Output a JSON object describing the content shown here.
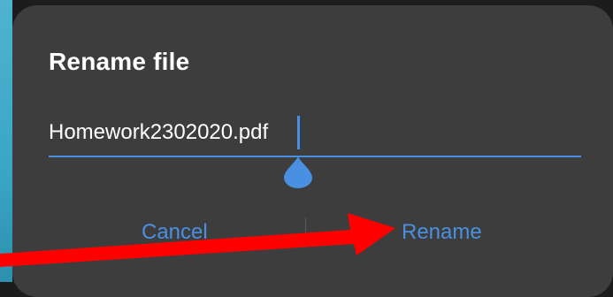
{
  "dialog": {
    "title": "Rename file",
    "filename_value": "Homework2302020.pdf",
    "cancel_label": "Cancel",
    "rename_label": "Rename"
  },
  "colors": {
    "dialog_bg": "#3d3d3d",
    "accent": "#4a90e2",
    "annotation_arrow": "#ff0000"
  },
  "icons": {
    "text_handle": "teardrop-selection-handle",
    "annotation": "red-arrow-pointing-to-rename"
  }
}
